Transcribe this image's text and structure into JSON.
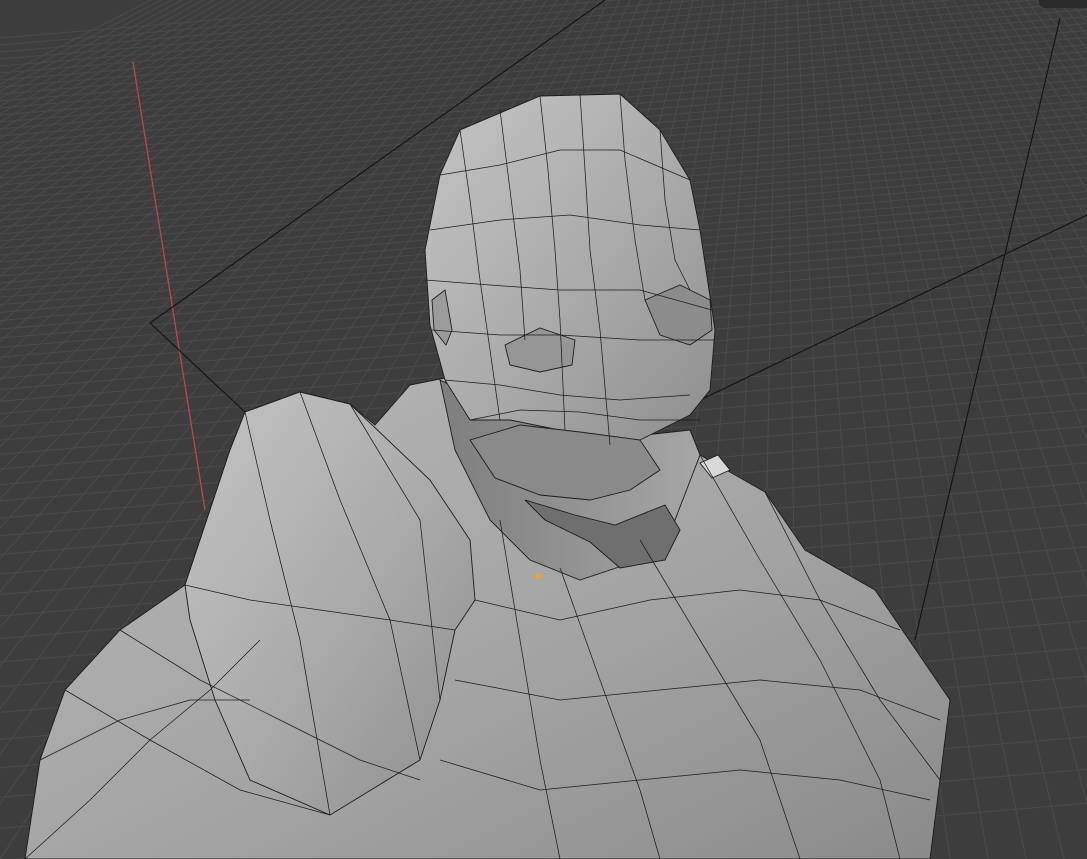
{
  "app": {
    "name": "3D viewport",
    "background_color": "#3d3d3d",
    "grid_color": "#4a4a4a",
    "x_axis_color": "#b64848",
    "mesh_fill": "#a9a9a9",
    "mesh_edge": "#1c1c1c",
    "selected_vertex_color": "#f0a030"
  },
  "viewport": {
    "object": "head-and-shoulders-mesh",
    "shading": "solid",
    "overlays": [
      "wireframe",
      "floor-grid",
      "x-axis",
      "camera-frustum"
    ]
  },
  "corner_badge": {
    "text": ""
  }
}
